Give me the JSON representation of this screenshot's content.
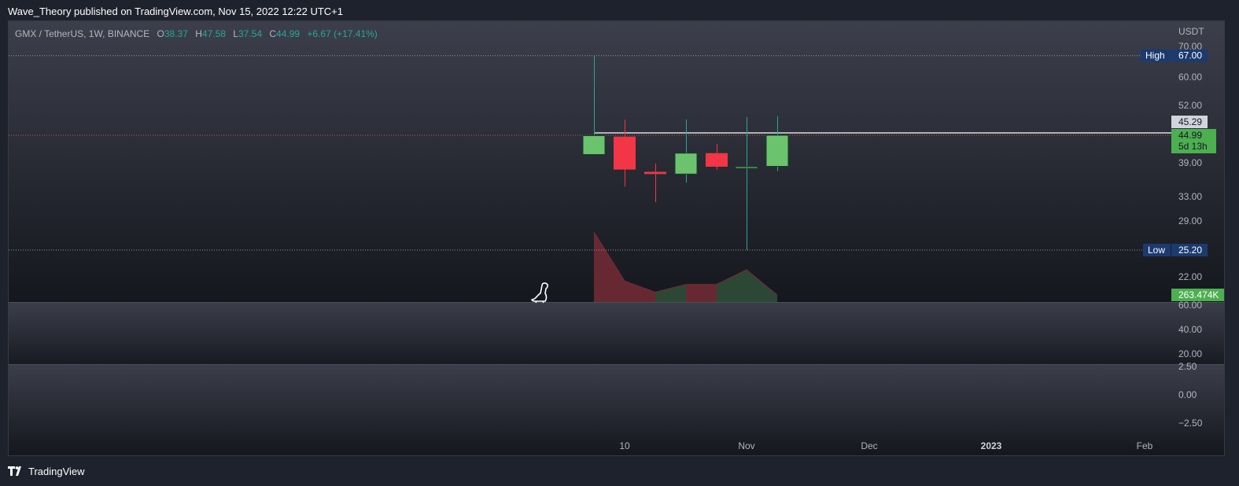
{
  "header": {
    "published_line": "Wave_Theory published on TradingView.com, Nov 15, 2022 12:22 UTC+1"
  },
  "legend": {
    "symbol": "GMX / TetherUS, 1W, BINANCE",
    "o_label": "O",
    "o_value": "38.37",
    "h_label": "H",
    "h_value": "47.58",
    "l_label": "L",
    "l_value": "37.54",
    "c_label": "C",
    "c_value": "44.99",
    "change": "+6.67 (+17.41%)"
  },
  "footer": {
    "brand": "TradingView"
  },
  "colors": {
    "background": "#1e222d",
    "up": "#6bc46d",
    "down": "#f23645",
    "volume_up": "#2d4b37",
    "volume_down": "#6b2a33",
    "high_low_badge": "#1c3a6e",
    "last_price_badge": "#4caf50"
  },
  "chart_data": {
    "type": "candlestick",
    "currency": "USDT",
    "price_ticks": [
      "70.00",
      "60.00",
      "52.00",
      "45.29",
      "44.99",
      "39.00",
      "33.00",
      "29.00",
      "25.20",
      "22.00"
    ],
    "price_tick_values": [
      70,
      60,
      52,
      39,
      33,
      29,
      22
    ],
    "candles": [
      {
        "open": 40.8,
        "high": 67.0,
        "low": 40.8,
        "close": 44.9
      },
      {
        "open": 44.7,
        "high": 46.2,
        "low": 34.8,
        "close": 37.8
      },
      {
        "open": 37.4,
        "high": 38.9,
        "low": 32.1,
        "close": 37.0
      },
      {
        "open": 37.0,
        "high": 46.3,
        "low": 35.5,
        "close": 41.1
      },
      {
        "open": 41.1,
        "high": 43.1,
        "low": 37.8,
        "close": 38.3
      },
      {
        "open": 38.2,
        "high": 47.2,
        "low": 25.2,
        "close": 38.3
      },
      {
        "open": 38.37,
        "high": 47.58,
        "low": 37.54,
        "close": 44.99
      }
    ],
    "volume": [
      1.0,
      0.3,
      0.14,
      0.25,
      0.25,
      0.46,
      0.1
    ],
    "high_label": "High",
    "high_value": "67.00",
    "low_label": "Low",
    "low_value": "25.20",
    "crosshair_value": "45.29",
    "last_price": "44.99",
    "countdown": "5d 13h",
    "volume_value": "263.474K",
    "pane2_ticks": [
      "60.00",
      "40.00",
      "20.00"
    ],
    "pane2_tick_values": [
      60,
      40,
      20
    ],
    "pane3_ticks": [
      "2.50",
      "0.00",
      "−2.50"
    ],
    "pane3_tick_values": [
      2.5,
      0,
      -2.5
    ],
    "x_ticks": [
      "10",
      "Nov",
      "Dec",
      "2023",
      "Feb"
    ]
  }
}
